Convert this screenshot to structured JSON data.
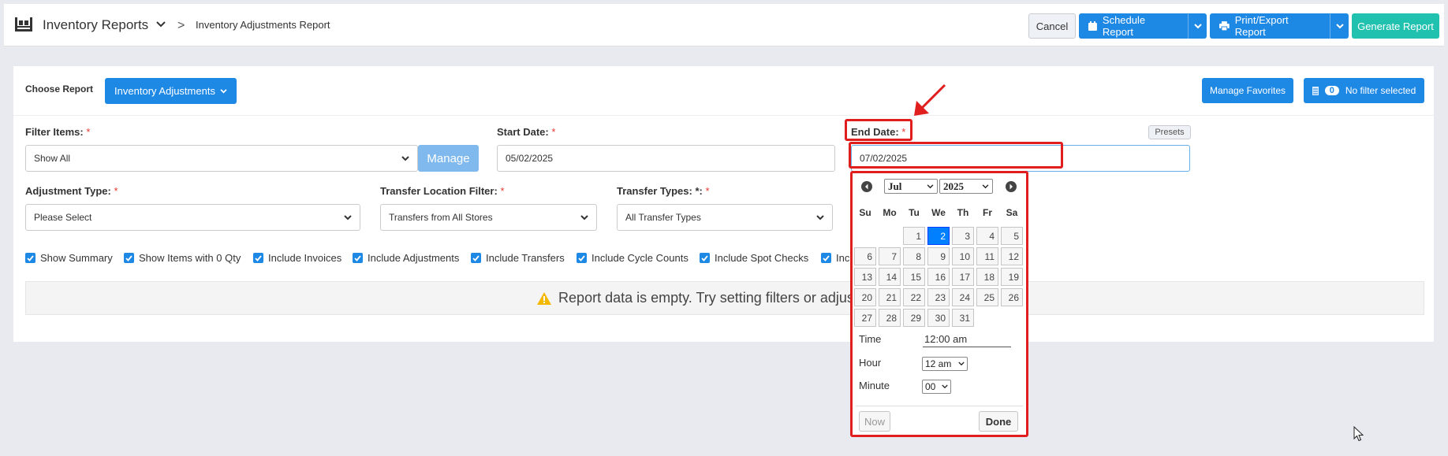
{
  "header": {
    "app_title": "Inventory Reports",
    "breadcrumb_sep": ">",
    "breadcrumb": "Inventory Adjustments Report",
    "cancel": "Cancel",
    "schedule": "Schedule Report",
    "print": "Print/Export Report",
    "generate": "Generate Report"
  },
  "report": {
    "choose_label": "Choose Report",
    "choose_value": "Inventory Adjustments",
    "manage_favorites": "Manage Favorites",
    "filter_count": "0",
    "filter_status": "No filter selected"
  },
  "filters": {
    "filter_items_label": "Filter Items:",
    "filter_items_value": "Show All",
    "manage": "Manage",
    "start_date_label": "Start Date:",
    "start_date_value": "05/02/2025",
    "end_date_label": "End Date:",
    "end_date_value": "07/02/2025",
    "presets": "Presets",
    "adjustment_type_label": "Adjustment Type:",
    "adjustment_type_value": "Please Select",
    "transfer_location_label": "Transfer Location Filter:",
    "transfer_location_value": "Transfers from All Stores",
    "transfer_types_label": "Transfer Types: *:",
    "transfer_types_value": "All Transfer Types",
    "required_mark": "*"
  },
  "checkboxes": [
    {
      "label": "Show Summary",
      "checked": true
    },
    {
      "label": "Show Items with 0 Qty",
      "checked": true
    },
    {
      "label": "Include Invoices",
      "checked": true
    },
    {
      "label": "Include Adjustments",
      "checked": true
    },
    {
      "label": "Include Transfers",
      "checked": true
    },
    {
      "label": "Include Cycle Counts",
      "checked": true
    },
    {
      "label": "Include Spot Checks",
      "checked": true
    },
    {
      "label": "Inc",
      "checked": true
    }
  ],
  "alert": {
    "text": "Report data is empty. Try setting filters or adjust the date"
  },
  "datepicker": {
    "month": "Jul",
    "year": "2025",
    "weekdays": [
      "Su",
      "Mo",
      "Tu",
      "We",
      "Th",
      "Fr",
      "Sa"
    ],
    "days": [
      "1",
      "2",
      "3",
      "4",
      "5",
      "6",
      "7",
      "8",
      "9",
      "10",
      "11",
      "12",
      "13",
      "14",
      "15",
      "16",
      "17",
      "18",
      "19",
      "20",
      "21",
      "22",
      "23",
      "24",
      "25",
      "26",
      "27",
      "28",
      "29",
      "30",
      "31"
    ],
    "selected_day": "2",
    "time_label": "Time",
    "time_value": "12:00 am",
    "hour_label": "Hour",
    "hour_value": "12 am",
    "minute_label": "Minute",
    "minute_value": "00",
    "now": "Now",
    "done": "Done"
  },
  "colors": {
    "accent": "#1e88e5",
    "teal": "#21c1b0",
    "annotation": "#e01e1e",
    "selected_day": "#007fff"
  }
}
